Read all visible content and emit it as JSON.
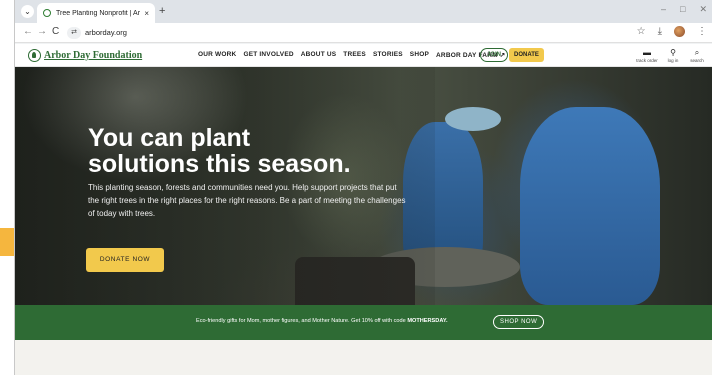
{
  "browser": {
    "tab_title": "Tree Planting Nonprofit | Arbo",
    "tab_close": "×",
    "new_tab": "+",
    "url": "arborday.org",
    "nav_back": "←",
    "nav_forward": "→",
    "nav_reload": "C",
    "site_info": "⇄",
    "bookmark": "☆",
    "downloads": "⤓",
    "menu": "⋮",
    "win_min": "–",
    "win_max": "□",
    "win_close": "✕"
  },
  "site": {
    "logo_text": "Arbor Day Foundation",
    "nav": [
      "OUR WORK",
      "GET INVOLVED",
      "ABOUT US",
      "TREES",
      "STORIES",
      "SHOP",
      "ARBOR DAY FARM ↗"
    ],
    "join": "JOIN",
    "donate": "DONATE",
    "utilities": [
      {
        "icon": "▬",
        "label": "track order"
      },
      {
        "icon": "⚲",
        "label": "log in"
      },
      {
        "icon": "⌕",
        "label": "search"
      }
    ]
  },
  "hero": {
    "title_line1": "You can plant",
    "title_line2": "solutions this season.",
    "body": "This planting season, forests and communities need you. Help support projects that put the right trees in the right places for the right reasons. Be a part of meeting the challenges of today with trees.",
    "cta": "DONATE NOW"
  },
  "promo": {
    "text": "Eco-friendly gifts for Mom, mother figures, and Mother Nature. Get 10% off with code ",
    "code": "MOTHERSDAY.",
    "button": "SHOP NOW"
  },
  "colors": {
    "brand_green": "#2e6b34",
    "accent_yellow": "#f2c94c",
    "pointer_orange": "#f5b63e"
  }
}
